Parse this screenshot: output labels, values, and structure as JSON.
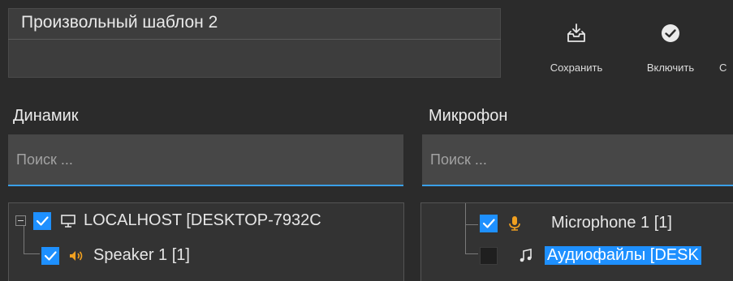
{
  "template": {
    "name": "Произвольный шаблон 2"
  },
  "toolbar": {
    "save_label": "Сохранить",
    "enable_label": "Включить",
    "more_label": "С"
  },
  "speaker": {
    "title": "Динамик",
    "search_placeholder": "Поиск ...",
    "tree": [
      {
        "label": "LOCALHOST [DESKTOP-7932C",
        "checked": true,
        "icon": "monitor-icon",
        "expanded": true
      },
      {
        "label": "Speaker 1 [1]",
        "checked": true,
        "icon": "speaker-icon"
      }
    ]
  },
  "microphone": {
    "title": "Микрофон",
    "search_placeholder": "Поиск ...",
    "tree": [
      {
        "label": "Microphone 1 [1]",
        "checked": true,
        "icon": "microphone-icon"
      },
      {
        "label": "Аудиофайлы [DESK",
        "checked": false,
        "icon": "music-note-icon",
        "selected": true
      }
    ]
  },
  "colors": {
    "accent": "#1e90ff",
    "background": "#2b2b2b",
    "icon_orange": "#f0a020"
  }
}
